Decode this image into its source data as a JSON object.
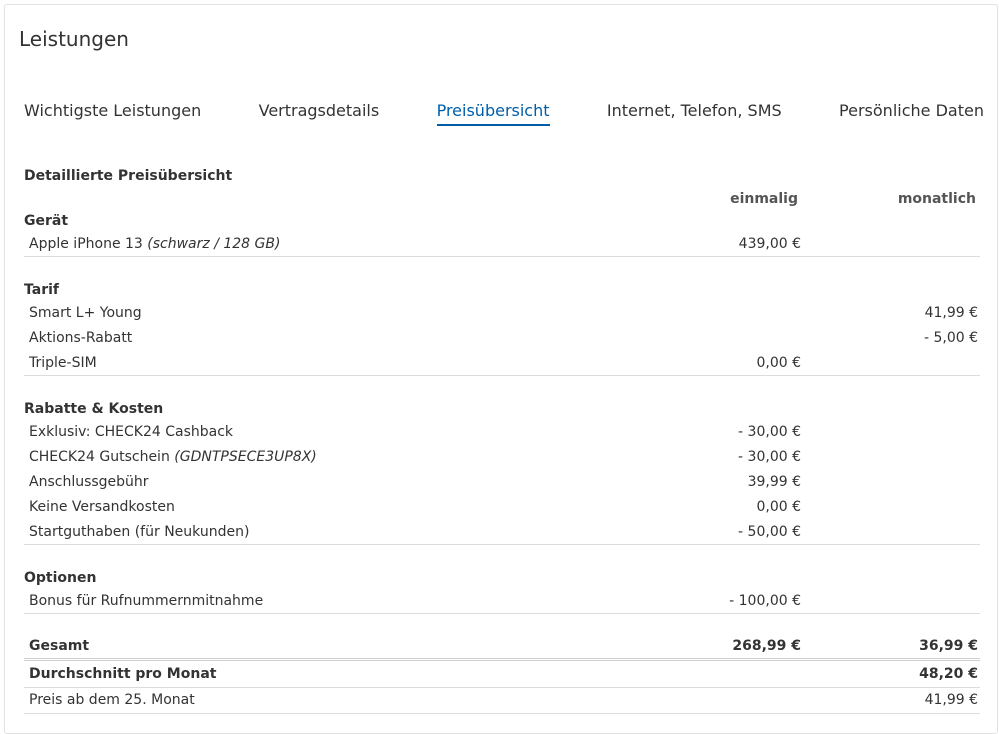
{
  "card": {
    "title": "Leistungen"
  },
  "tabs": [
    {
      "label": "Wichtigste Leistungen",
      "active": false
    },
    {
      "label": "Vertragsdetails",
      "active": false
    },
    {
      "label": "Preisübersicht",
      "active": true
    },
    {
      "label": "Internet, Telefon, SMS",
      "active": false
    },
    {
      "label": "Persönliche Daten",
      "active": false
    }
  ],
  "price": {
    "title": "Detaillierte Preisübersicht",
    "col_once": "einmalig",
    "col_month": "monatlich",
    "sections": [
      {
        "title": "Gerät",
        "rows": [
          {
            "label": "Apple iPhone 13",
            "note": "(schwarz / 128 GB)",
            "once": "439,00 €",
            "month": ""
          }
        ]
      },
      {
        "title": "Tarif",
        "rows": [
          {
            "label": "Smart L+ Young",
            "note": "",
            "once": "",
            "month": "41,99 €"
          },
          {
            "label": "Aktions-Rabatt",
            "note": "",
            "once": "",
            "month": "- 5,00 €"
          },
          {
            "label": "Triple-SIM",
            "note": "",
            "once": "0,00 €",
            "month": ""
          }
        ]
      },
      {
        "title": "Rabatte & Kosten",
        "rows": [
          {
            "label": "Exklusiv: CHECK24 Cashback",
            "note": "",
            "once": "- 30,00 €",
            "month": ""
          },
          {
            "label": "CHECK24 Gutschein",
            "note": "(GDNTPSECE3UP8X)",
            "once": "- 30,00 €",
            "month": ""
          },
          {
            "label": "Anschlussgebühr",
            "note": "",
            "once": "39,99 €",
            "month": ""
          },
          {
            "label": "Keine Versandkosten",
            "note": "",
            "once": "0,00 €",
            "month": ""
          },
          {
            "label": "Startguthaben (für Neukunden)",
            "note": "",
            "once": "- 50,00 €",
            "month": ""
          }
        ]
      },
      {
        "title": "Optionen",
        "rows": [
          {
            "label": "Bonus für Rufnummernmitnahme",
            "note": "",
            "once": "- 100,00 €",
            "month": ""
          }
        ]
      }
    ],
    "total": {
      "label": "Gesamt",
      "once": "268,99 €",
      "month": "36,99 €"
    },
    "average": {
      "label": "Durchschnitt pro Monat",
      "month": "48,20 €"
    },
    "after": {
      "label": "Preis ab dem 25. Monat",
      "month": "41,99 €"
    }
  }
}
